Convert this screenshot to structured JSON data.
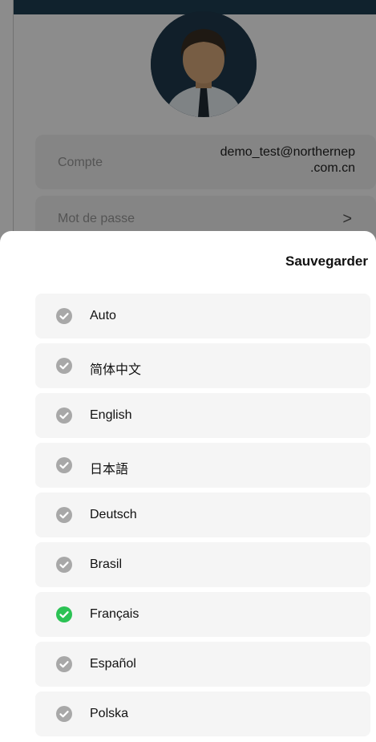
{
  "profile": {
    "account_label": "Compte",
    "account_value_line1": "demo_test@northernep",
    "account_value_line2": ".com.cn",
    "password_label": "Mot de passe",
    "password_chevron": ">"
  },
  "sheet": {
    "save_label": "Sauvegarder",
    "languages": [
      {
        "label": "Auto",
        "selected": false
      },
      {
        "label": "简体中文",
        "selected": false
      },
      {
        "label": "English",
        "selected": false
      },
      {
        "label": "日本語",
        "selected": false
      },
      {
        "label": "Deutsch",
        "selected": false
      },
      {
        "label": "Brasil",
        "selected": false
      },
      {
        "label": "Français",
        "selected": true
      },
      {
        "label": "Español",
        "selected": false
      },
      {
        "label": "Polska",
        "selected": false
      }
    ]
  },
  "colors": {
    "selected_check": "#2bc254",
    "unselected_check": "#a8a8a8",
    "top_bar": "#1e3f52"
  },
  "icons": {
    "check": "check-circle-icon",
    "chevron": "chevron-right-icon",
    "avatar": "user-avatar"
  }
}
